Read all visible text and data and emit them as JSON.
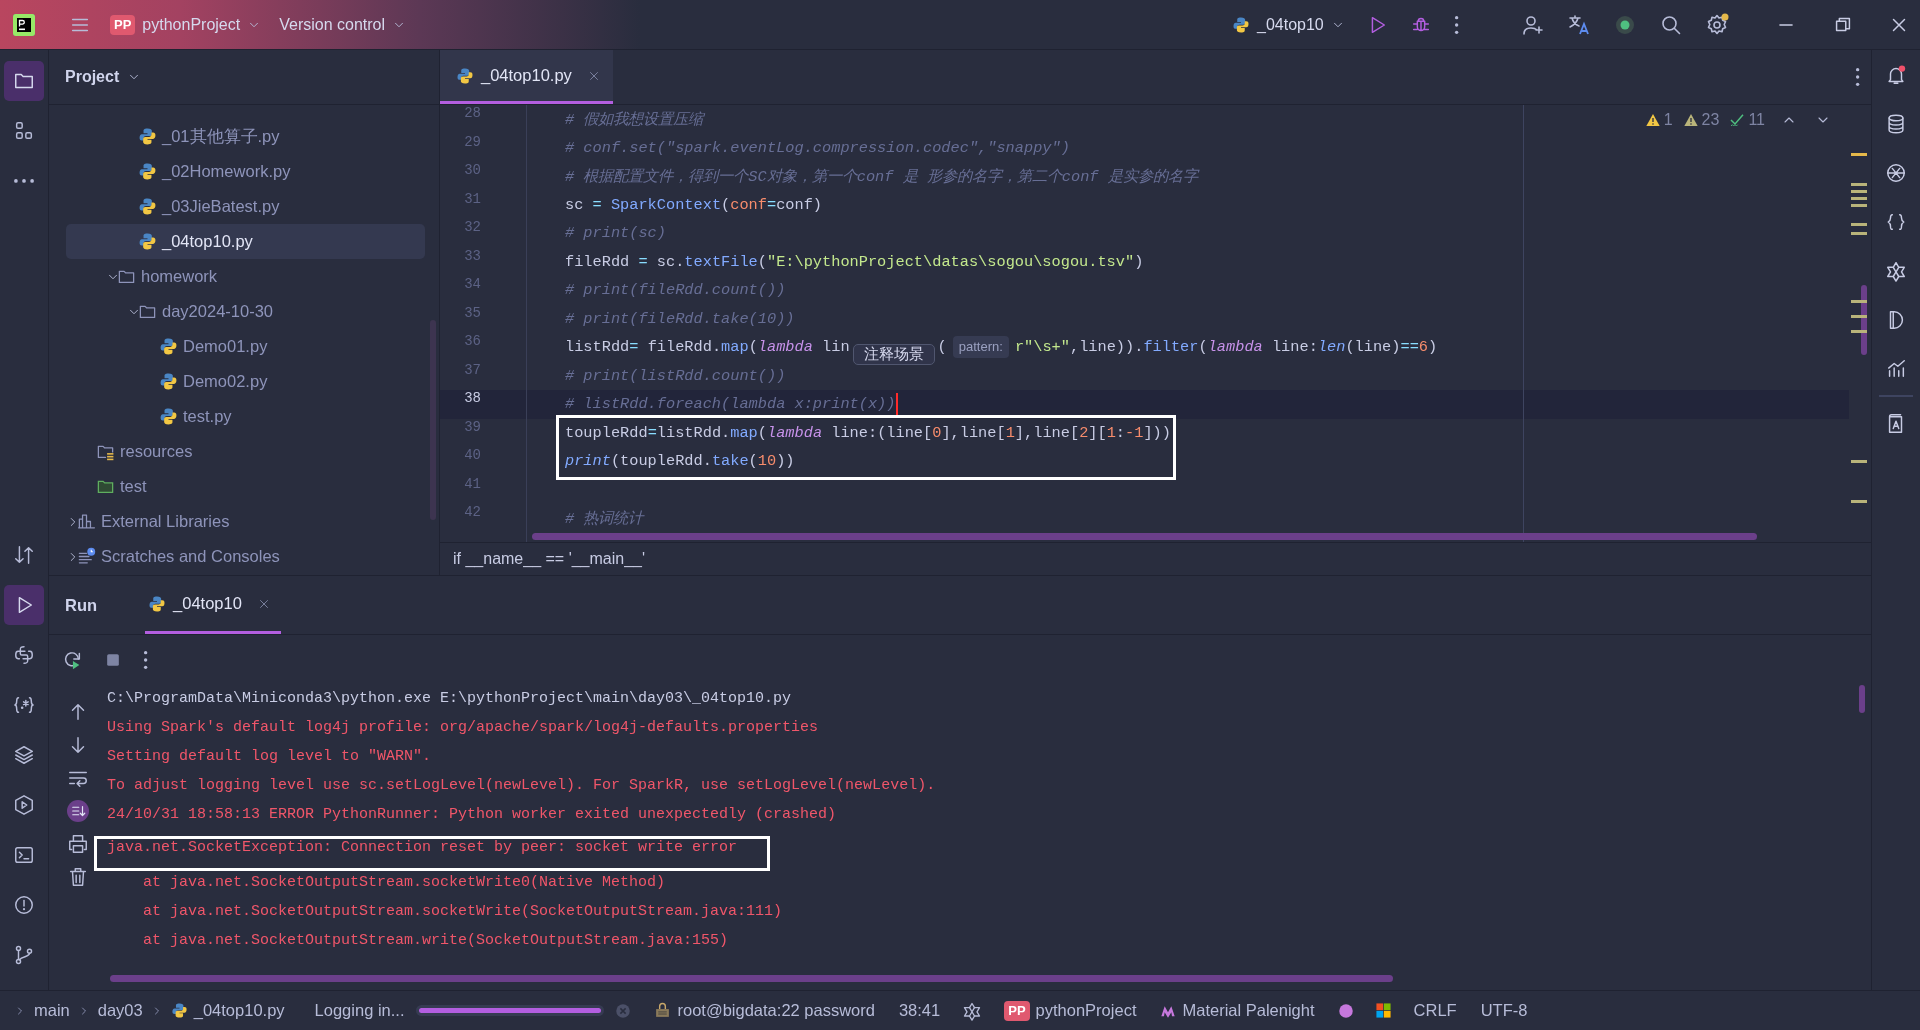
{
  "title_bar": {
    "project_badge": "PP",
    "project": "pythonProject",
    "vcs": "Version control",
    "run_config": "_04top10"
  },
  "left_toolbar": {
    "top": [
      {
        "kind": "project",
        "selected": true
      },
      {
        "kind": "structure",
        "selected": false
      },
      {
        "kind": "more",
        "selected": false
      }
    ],
    "bottom": [
      {
        "kind": "commit",
        "selected": false
      },
      {
        "kind": "run",
        "selected": true
      },
      {
        "kind": "python-console",
        "selected": false
      },
      {
        "kind": "regex",
        "selected": false
      },
      {
        "kind": "layers",
        "selected": false
      },
      {
        "kind": "services",
        "selected": false
      },
      {
        "kind": "terminal",
        "selected": false
      },
      {
        "kind": "problems",
        "selected": false
      },
      {
        "kind": "git",
        "selected": false
      }
    ]
  },
  "project_panel": {
    "title": "Project",
    "tree": [
      {
        "children": [
          {
            "children": [
              {
                "children": [
                  {
                    "label": "_01其他算子.py",
                    "kind": "python",
                    "selected": false
                  },
                  {
                    "label": "_02Homework.py",
                    "kind": "python",
                    "selected": false
                  },
                  {
                    "label": "_03JieBatest.py",
                    "kind": "python",
                    "selected": false
                  },
                  {
                    "label": "_04top10.py",
                    "kind": "python",
                    "selected": true
                  }
                ]
              },
              {
                "label": "homework",
                "kind": "folder",
                "selected": false,
                "expanded": true,
                "children": [
                  {
                    "label": "day2024-10-30",
                    "kind": "folder",
                    "selected": false,
                    "expanded": true,
                    "children": [
                      {
                        "label": "Demo01.py",
                        "kind": "python",
                        "selected": false
                      },
                      {
                        "label": "Demo02.py",
                        "kind": "python",
                        "selected": false
                      },
                      {
                        "label": "test.py",
                        "kind": "python",
                        "selected": false
                      }
                    ]
                  }
                ]
              }
            ]
          },
          {
            "label": "resources",
            "kind": "resources",
            "selected": false
          },
          {
            "label": "test",
            "kind": "test",
            "selected": false
          }
        ]
      },
      {
        "label": "External Libraries",
        "kind": "library",
        "selected": false,
        "expanded": false
      },
      {
        "label": "Scratches and Consoles",
        "kind": "scratches",
        "selected": false,
        "expanded": false
      }
    ]
  },
  "editor": {
    "tabs": [
      {
        "label": "_04top10.py",
        "selected": true
      }
    ],
    "inspections": [
      {
        "kind": "error",
        "count": "1"
      },
      {
        "kind": "warning",
        "count": "23"
      },
      {
        "kind": "typo",
        "count": "11"
      }
    ],
    "lines": [
      {
        "number": "28",
        "current": false,
        "boxed": false,
        "segments": [
          {
            "text": "# 假如我想设置压缩",
            "kind": "comment"
          }
        ]
      },
      {
        "number": "29",
        "current": false,
        "boxed": false,
        "segments": [
          {
            "text": "# conf.set(\"spark.eventLog.compression.codec\",\"snappy\")",
            "kind": "comment"
          }
        ]
      },
      {
        "number": "30",
        "current": false,
        "boxed": false,
        "segments": [
          {
            "text": "# 根据配置文件，得到一个SC对象，第一个conf 是 形参的名字，第二个conf 是实参的名字",
            "kind": "comment"
          }
        ]
      },
      {
        "number": "31",
        "current": false,
        "boxed": false,
        "segments": [
          {
            "text": "sc ",
            "kind": "plain"
          },
          {
            "text": "= ",
            "kind": "operator"
          },
          {
            "text": "SparkContext",
            "kind": "function"
          },
          {
            "text": "(",
            "kind": "plain"
          },
          {
            "text": "conf",
            "kind": "argument"
          },
          {
            "text": "=",
            "kind": "operator"
          },
          {
            "text": "conf)",
            "kind": "plain"
          }
        ]
      },
      {
        "number": "32",
        "current": false,
        "boxed": false,
        "segments": [
          {
            "text": "# print(sc)",
            "kind": "comment"
          }
        ]
      },
      {
        "number": "33",
        "current": false,
        "boxed": false,
        "segments": [
          {
            "text": "fileRdd ",
            "kind": "plain"
          },
          {
            "text": "= ",
            "kind": "operator"
          },
          {
            "text": "sc.",
            "kind": "plain"
          },
          {
            "text": "textFile",
            "kind": "function"
          },
          {
            "text": "(",
            "kind": "plain"
          },
          {
            "text": "\"E:\\pythonProject\\datas\\sogou\\sogou.tsv\"",
            "kind": "string"
          },
          {
            "text": ")",
            "kind": "plain"
          }
        ]
      },
      {
        "number": "34",
        "current": false,
        "boxed": false,
        "segments": [
          {
            "text": "# print(fileRdd.count())",
            "kind": "comment"
          }
        ]
      },
      {
        "number": "35",
        "current": false,
        "boxed": false,
        "segments": [
          {
            "text": "# print(fileRdd.take(10))",
            "kind": "comment"
          }
        ]
      },
      {
        "number": "36",
        "current": false,
        "boxed": false,
        "segments": [
          {
            "text": "listRdd",
            "kind": "plain"
          },
          {
            "text": "=",
            "kind": "operator"
          },
          {
            "text": " fileRdd.",
            "kind": "plain"
          },
          {
            "text": "map",
            "kind": "function"
          },
          {
            "text": "(",
            "kind": "plain"
          },
          {
            "text": "lambda",
            "kind": "keyword"
          },
          {
            "text": " lin",
            "kind": "plain"
          },
          {
            "text": "注释场景",
            "kind": "tooltip"
          },
          {
            "text": "(",
            "kind": "plain"
          },
          {
            "text": "pattern:",
            "kind": "hint"
          },
          {
            "text": "r\"\\s+\"",
            "kind": "string"
          },
          {
            "text": ",line)).",
            "kind": "plain"
          },
          {
            "text": "filter",
            "kind": "function"
          },
          {
            "text": "(",
            "kind": "plain"
          },
          {
            "text": "lambda",
            "kind": "keyword"
          },
          {
            "text": " line:",
            "kind": "plain"
          },
          {
            "text": "len",
            "kind": "builtin"
          },
          {
            "text": "(line)",
            "kind": "plain"
          },
          {
            "text": "==",
            "kind": "operator"
          },
          {
            "text": "6",
            "kind": "number"
          },
          {
            "text": ")",
            "kind": "plain"
          }
        ]
      },
      {
        "number": "37",
        "current": false,
        "boxed": false,
        "segments": [
          {
            "text": "# print(listRdd.count())",
            "kind": "comment"
          }
        ]
      },
      {
        "number": "38",
        "current": true,
        "boxed": false,
        "segments": [
          {
            "text": "# listRdd.foreach(lambda x:print(x))",
            "kind": "comment"
          }
        ]
      },
      {
        "number": "39",
        "current": false,
        "boxed": true,
        "segments": [
          {
            "text": "toupleRdd",
            "kind": "plain"
          },
          {
            "text": "=",
            "kind": "operator"
          },
          {
            "text": "listRdd.",
            "kind": "plain"
          },
          {
            "text": "map",
            "kind": "function"
          },
          {
            "text": "(",
            "kind": "plain"
          },
          {
            "text": "lambda",
            "kind": "keyword"
          },
          {
            "text": " line:(line[",
            "kind": "plain"
          },
          {
            "text": "0",
            "kind": "number"
          },
          {
            "text": "],line[",
            "kind": "plain"
          },
          {
            "text": "1",
            "kind": "number"
          },
          {
            "text": "],line[",
            "kind": "plain"
          },
          {
            "text": "2",
            "kind": "number"
          },
          {
            "text": "][",
            "kind": "plain"
          },
          {
            "text": "1",
            "kind": "number"
          },
          {
            "text": ":",
            "kind": "plain"
          },
          {
            "text": "-1",
            "kind": "number"
          },
          {
            "text": "]))",
            "kind": "plain"
          }
        ]
      },
      {
        "number": "40",
        "current": false,
        "boxed": true,
        "segments": [
          {
            "text": "print",
            "kind": "builtin"
          },
          {
            "text": "(toupleRdd.",
            "kind": "plain"
          },
          {
            "text": "take",
            "kind": "function"
          },
          {
            "text": "(",
            "kind": "plain"
          },
          {
            "text": "10",
            "kind": "number"
          },
          {
            "text": "))",
            "kind": "plain"
          }
        ]
      },
      {
        "number": "41",
        "current": false,
        "boxed": false
      },
      {
        "number": "42",
        "current": false,
        "boxed": false,
        "segments": [
          {
            "text": "# 热词统计",
            "kind": "comment"
          }
        ]
      }
    ],
    "breadcrumb": "if __name__ == '__main__'"
  },
  "run_panel": {
    "title": "Run",
    "tabs": [
      {
        "label": "_04top10",
        "selected": true
      }
    ],
    "console": [
      {
        "text": "C:\\ProgramData\\Miniconda3\\python.exe E:\\pythonProject\\main\\day03\\_04top10.py",
        "kind": "command",
        "boxed": false
      },
      {
        "text": "Using Spark's default log4j profile: org/apache/spark/log4j-defaults.properties",
        "kind": "stderr",
        "boxed": false
      },
      {
        "text": "Setting default log level to \"WARN\".",
        "kind": "stderr",
        "boxed": false
      },
      {
        "text": "To adjust logging level use sc.setLogLevel(newLevel). For SparkR, use setLogLevel(newLevel).",
        "kind": "stderr",
        "boxed": false
      },
      {
        "text": "24/10/31 18:58:13 ERROR PythonRunner: Python worker exited unexpectedly (crashed)",
        "kind": "stderr",
        "boxed": false
      },
      {
        "text": "java.net.SocketException: Connection reset by peer: socket write error",
        "kind": "stderr",
        "boxed": true
      },
      {
        "text": "    at java.net.SocketOutputStream.socketWrite0(Native Method)",
        "kind": "stderr",
        "boxed": false
      },
      {
        "text": "    at java.net.SocketOutputStream.socketWrite(SocketOutputStream.java:111)",
        "kind": "stderr",
        "boxed": false
      },
      {
        "text": "    at java.net.SocketOutputStream.write(SocketOutputStream.java:155)",
        "kind": "stderr",
        "boxed": false
      }
    ]
  },
  "status_bar": {
    "path": [
      {
        "label": "main",
        "kind": "folder"
      },
      {
        "label": "day03",
        "kind": "folder"
      },
      {
        "label": "_04top10.py",
        "kind": "python"
      }
    ],
    "task": "Logging in...",
    "progress": {
      "level": 1
    },
    "connection": "root@bigdata:22 password",
    "position": "38:41",
    "project_badge": "PP",
    "project": "pythonProject",
    "theme": "Material Palenight",
    "line_separator": "CRLF",
    "encoding": "UTF-8"
  }
}
